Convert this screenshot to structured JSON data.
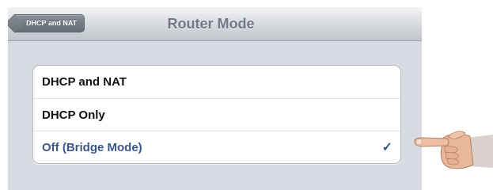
{
  "navbar": {
    "back_label": "DHCP and NAT",
    "title": "Router Mode"
  },
  "options": [
    {
      "label": "DHCP and NAT",
      "selected": false
    },
    {
      "label": "DHCP Only",
      "selected": false
    },
    {
      "label": "Off (Bridge Mode)",
      "selected": true
    }
  ],
  "checkmark_glyph": "✓",
  "icons": {
    "back": "back-arrow-icon",
    "check": "checkmark-icon",
    "pointer": "pointing-hand-icon"
  },
  "colors": {
    "selected_text": "#3c5688",
    "navbar_title": "#707a86",
    "background": "#d8dbe1"
  }
}
